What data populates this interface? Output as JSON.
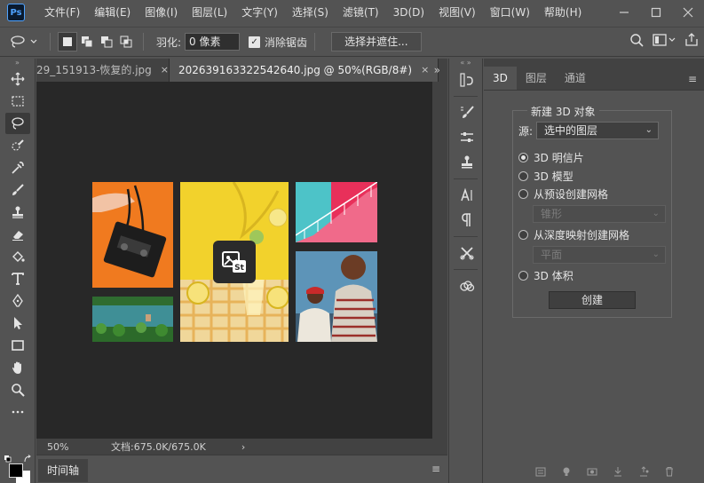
{
  "app": {
    "logo": "Ps",
    "menu": [
      "文件(F)",
      "编辑(E)",
      "图像(I)",
      "图层(L)",
      "文字(Y)",
      "选择(S)",
      "滤镜(T)",
      "3D(D)",
      "视图(V)",
      "窗口(W)",
      "帮助(H)"
    ]
  },
  "options_bar": {
    "feather_label": "羽化:",
    "feather_value": "0 像素",
    "antialias_label": "消除锯齿",
    "antialias_checked": true,
    "select_mask_label": "选择并遮住..."
  },
  "tabs": [
    {
      "label": "29_151913-恢复的.jpg",
      "active": false,
      "close": "×"
    },
    {
      "label": "2026391633225426​40.jpg @ 50%(RGB/8#)",
      "active": true,
      "close": "×"
    }
  ],
  "tab_overflow": "»",
  "status": {
    "zoom": "50%",
    "docinfo": "文档:675.0K/675.0K",
    "arrow": "›"
  },
  "timeline": {
    "tab_label": "时间轴",
    "menu": "≡"
  },
  "panel": {
    "tabs": [
      "3D",
      "图层",
      "通道"
    ],
    "active_tab": "3D",
    "menu": "≡",
    "new_object_title": "新建 3D 对象",
    "source_label": "源:",
    "source_value": "选中的图层",
    "options": [
      {
        "label": "3D 明信片",
        "selected": true
      },
      {
        "label": "3D 模型",
        "selected": false
      },
      {
        "label": "从预设创建网格",
        "selected": false
      },
      {
        "label": "从深度映射创建网格",
        "selected": false
      },
      {
        "label": "3D 体积",
        "selected": false
      }
    ],
    "preset_value": "锥形",
    "depth_value": "平面",
    "create_label": "创建"
  },
  "colors": {
    "chrome": "#535353",
    "dark": "#424242",
    "canvas": "#282828",
    "ps_blue": "#4ea2ff"
  }
}
